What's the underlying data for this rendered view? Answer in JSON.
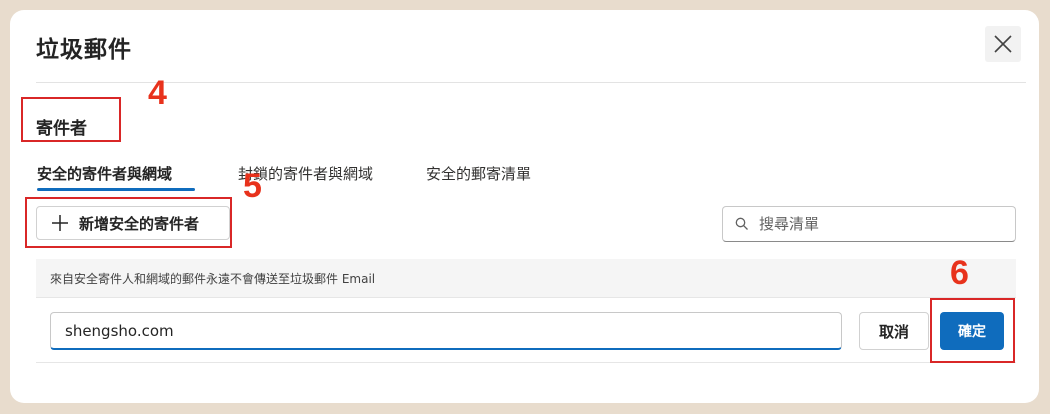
{
  "dialog": {
    "title": "垃圾郵件",
    "close_icon": "close-icon"
  },
  "section": {
    "heading": "寄件者"
  },
  "tabs": [
    {
      "label": "安全的寄件者與網域",
      "active": true
    },
    {
      "label": "封鎖的寄件者與網域",
      "active": false
    },
    {
      "label": "安全的郵寄清單",
      "active": false
    }
  ],
  "toolbar": {
    "add_label": "新增安全的寄件者",
    "add_icon": "plus-icon",
    "search_placeholder": "搜尋清單",
    "search_icon": "search-icon"
  },
  "info": {
    "text": "來自安全寄件人和網域的郵件永遠不會傳送至垃圾郵件 Email"
  },
  "entry": {
    "value": "shengsho.com",
    "cancel_label": "取消",
    "confirm_label": "確定"
  },
  "annotations": {
    "step4": "4",
    "step5": "5",
    "step6": "6",
    "color": "#e8321c"
  },
  "colors": {
    "accent": "#0f6cbd",
    "background": "#e8dccd",
    "highlight": "#d92727"
  }
}
